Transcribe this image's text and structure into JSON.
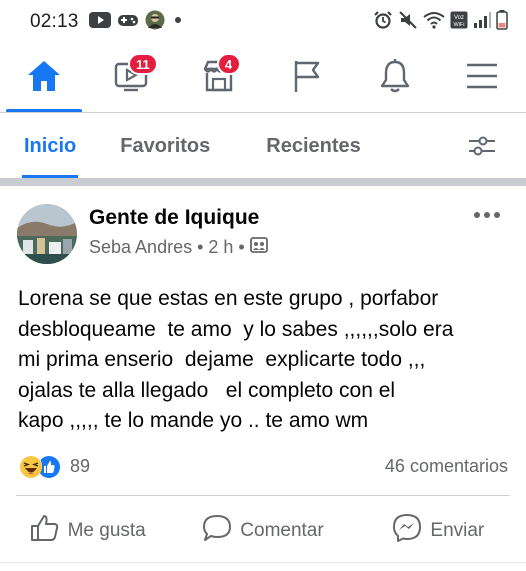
{
  "status_bar": {
    "time": "02:13",
    "left_icons": [
      "youtube-icon",
      "game-controller-icon",
      "avatar-notification-icon",
      "dot-icon"
    ],
    "right_icons": [
      "alarm-icon",
      "mute-icon",
      "wifi-icon",
      "volte-icon",
      "signal-icon",
      "battery-icon"
    ],
    "volte_label": "Voz\nWiFi"
  },
  "top_nav": {
    "items": [
      {
        "name": "home",
        "icon": "home-icon",
        "active": true
      },
      {
        "name": "watch",
        "icon": "video-icon",
        "badge": "11"
      },
      {
        "name": "marketplace",
        "icon": "shop-icon",
        "badge": "4"
      },
      {
        "name": "pages",
        "icon": "flag-icon"
      },
      {
        "name": "notifications",
        "icon": "bell-icon"
      },
      {
        "name": "menu",
        "icon": "hamburger-icon"
      }
    ],
    "accent": "#1877f2",
    "badge_color": "#e41e3f"
  },
  "tabs": {
    "items": [
      "Inicio",
      "Favoritos",
      "Recientes"
    ],
    "active": "Inicio",
    "filter_icon": "filter-sliders-icon"
  },
  "post": {
    "group_name": "Gente de Iquique",
    "author": "Seba Andres",
    "time": "2 h",
    "separator": "•",
    "audience_icon": "group-audience-icon",
    "body": "Lorena se que estas en este grupo , porfabor\ndesbloqueame  te amo  y lo sabes ,,,,,,solo era\nmi prima enserio  dejame  explicarte todo ,,,\nojalas te alla llegado   el completo con el\nkapo ,,,,, te lo mande yo .. te amo wm",
    "reactions": {
      "icons": [
        "haha-icon",
        "like-icon"
      ],
      "count": "89"
    },
    "comments": "46 comentarios",
    "actions": [
      {
        "label": "Me gusta",
        "icon": "thumbs-up-icon"
      },
      {
        "label": "Comentar",
        "icon": "comment-icon"
      },
      {
        "label": "Enviar",
        "icon": "messenger-icon"
      }
    ]
  }
}
